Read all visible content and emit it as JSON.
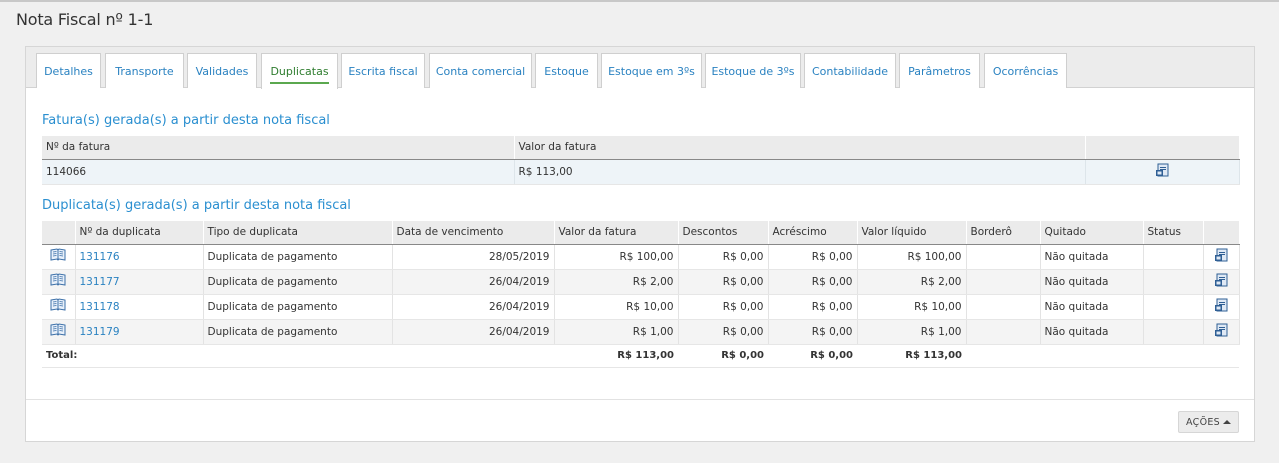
{
  "page": {
    "title": "Nota Fiscal nº 1-1"
  },
  "tabs": [
    {
      "label": "Detalhes"
    },
    {
      "label": "Transporte"
    },
    {
      "label": "Validades"
    },
    {
      "label": "Duplicatas",
      "active": true
    },
    {
      "label": "Escrita fiscal"
    },
    {
      "label": "Conta comercial"
    },
    {
      "label": "Estoque"
    },
    {
      "label": "Estoque em 3ºs"
    },
    {
      "label": "Estoque de 3ºs"
    },
    {
      "label": "Contabilidade"
    },
    {
      "label": "Parâmetros"
    },
    {
      "label": "Ocorrências"
    }
  ],
  "faturas": {
    "title": "Fatura(s) gerada(s) a partir desta nota fiscal",
    "headers": {
      "numero": "Nº da fatura",
      "valor": "Valor da fatura"
    },
    "rows": [
      {
        "numero": "114066",
        "valor": "R$ 113,00"
      }
    ]
  },
  "duplicatas": {
    "title": "Duplicata(s) gerada(s) a partir desta nota fiscal",
    "headers": {
      "numero": "Nº da duplicata",
      "tipo": "Tipo de duplicata",
      "vencimento": "Data de vencimento",
      "valor": "Valor da fatura",
      "descontos": "Descontos",
      "acrescimo": "Acréscimo",
      "liquido": "Valor líquido",
      "bordero": "Borderô",
      "quitado": "Quitado",
      "status": "Status"
    },
    "rows": [
      {
        "numero": "131176",
        "tipo": "Duplicata de pagamento",
        "vencimento": "28/05/2019",
        "valor": "R$ 100,00",
        "descontos": "R$ 0,00",
        "acrescimo": "R$ 0,00",
        "liquido": "R$ 100,00",
        "bordero": "",
        "quitado": "Não quitada",
        "status": ""
      },
      {
        "numero": "131177",
        "tipo": "Duplicata de pagamento",
        "vencimento": "26/04/2019",
        "valor": "R$ 2,00",
        "descontos": "R$ 0,00",
        "acrescimo": "R$ 0,00",
        "liquido": "R$ 2,00",
        "bordero": "",
        "quitado": "Não quitada",
        "status": ""
      },
      {
        "numero": "131178",
        "tipo": "Duplicata de pagamento",
        "vencimento": "26/04/2019",
        "valor": "R$ 10,00",
        "descontos": "R$ 0,00",
        "acrescimo": "R$ 0,00",
        "liquido": "R$ 10,00",
        "bordero": "",
        "quitado": "Não quitada",
        "status": ""
      },
      {
        "numero": "131179",
        "tipo": "Duplicata de pagamento",
        "vencimento": "26/04/2019",
        "valor": "R$ 1,00",
        "descontos": "R$ 0,00",
        "acrescimo": "R$ 0,00",
        "liquido": "R$ 1,00",
        "bordero": "",
        "quitado": "Não quitada",
        "status": ""
      }
    ],
    "total": {
      "label": "Total:",
      "valor": "R$ 113,00",
      "descontos": "R$ 0,00",
      "acrescimo": "R$ 0,00",
      "liquido": "R$ 113,00"
    }
  },
  "actions": {
    "acoes_label": "AÇÕES"
  },
  "icons": {
    "row_detail": "book-icon",
    "print": "print-document-icon"
  },
  "colors": {
    "link": "#2a82c1",
    "section_title": "#2a8fd0",
    "active_tab": "#5ba84f"
  }
}
